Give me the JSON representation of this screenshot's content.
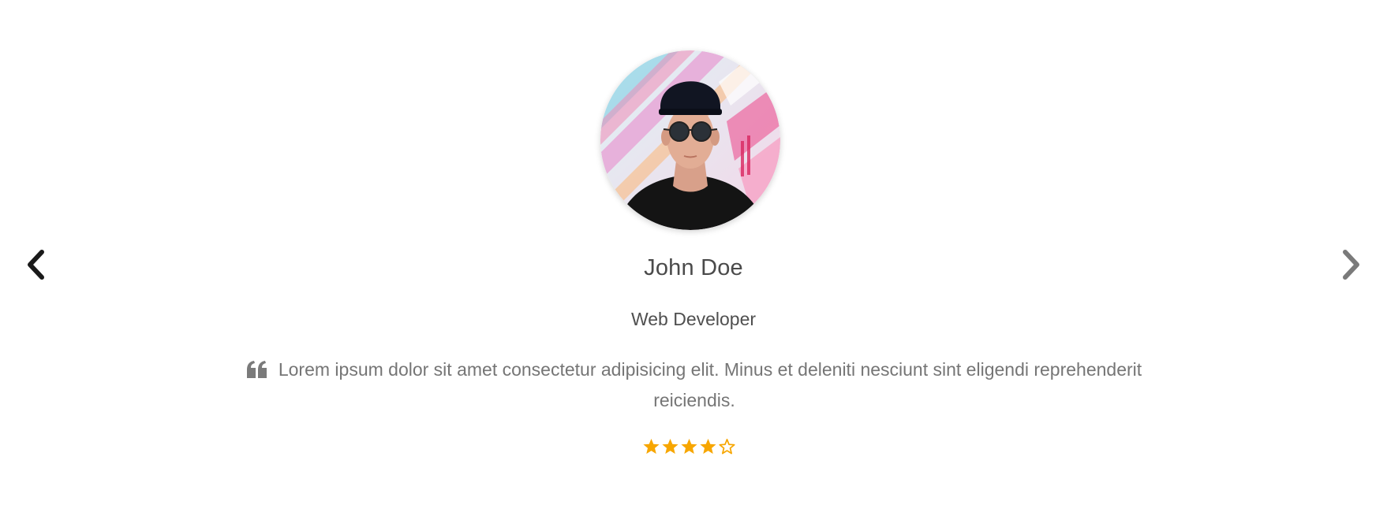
{
  "testimonial": {
    "name": "John Doe",
    "role": "Web Developer",
    "quote": "Lorem ipsum dolor sit amet consectetur adipisicing elit. Minus et deleniti nesciunt sint eligendi reprehenderit reiciendis.",
    "rating": 4,
    "rating_max": 5
  },
  "icons": {
    "prev": "chevron-left-icon",
    "next": "chevron-right-icon",
    "quote": "quote-left-icon",
    "star_full": "star-icon",
    "star_empty": "star-outline-icon"
  },
  "colors": {
    "star": "#f7a600",
    "prev_arrow": "#1a1a1a",
    "next_arrow": "#7a7a7a"
  }
}
